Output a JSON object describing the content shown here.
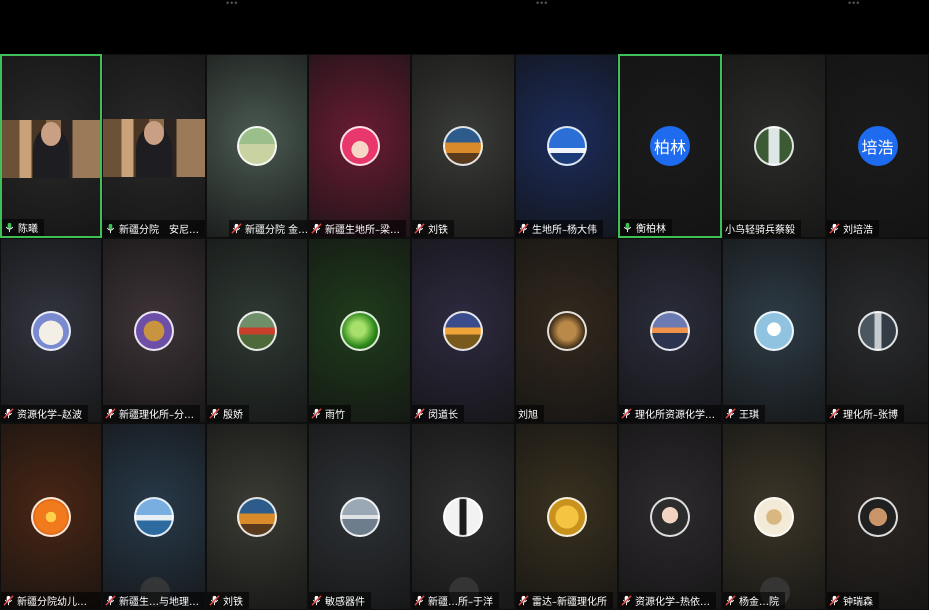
{
  "colors": {
    "active_border": "#3fbf56",
    "mic_muted": "#e24646",
    "host_badge": "#f08a1c",
    "avatar_blue": "#1f6bf0"
  },
  "participants": [
    {
      "name": "陈曦",
      "mic": "on",
      "bg": "#2a2a2a",
      "kind": "video",
      "active": true
    },
    {
      "name": "新疆分院　安尼…",
      "mic": "on",
      "bg": "#2a2a2a",
      "kind": "video",
      "active": false
    },
    {
      "name": "新疆分院 金…",
      "mic": "muted",
      "bg": "#4b5a52",
      "kind": "avatar",
      "icon": "landscape-icon",
      "host": true
    },
    {
      "name": "新疆生地所–梁…",
      "mic": "muted",
      "bg": "#6a1c34",
      "kind": "avatar",
      "icon": "cartoon-girl-icon"
    },
    {
      "name": "刘铁",
      "mic": "muted",
      "bg": "#3a3c38",
      "kind": "avatar",
      "icon": "train-sunset-icon"
    },
    {
      "name": "生地所–杨大伟",
      "mic": "muted",
      "bg": "#1c2c5c",
      "kind": "avatar",
      "icon": "blue-sky-icon"
    },
    {
      "name": "衡柏林",
      "mic": "on",
      "bg": "#1b1b1b",
      "kind": "text-avatar",
      "initials": "柏林",
      "active": true
    },
    {
      "name": "小鸟轻骑兵蔡毅",
      "mic": "none",
      "bg": "#2c2d2a",
      "kind": "avatar",
      "icon": "waterfall-icon"
    },
    {
      "name": "刘培浩",
      "mic": "muted",
      "bg": "#1b1b1b",
      "kind": "text-avatar",
      "initials": "培浩"
    },
    {
      "name": "资源化学–赵波",
      "mic": "muted",
      "bg": "#32343e",
      "kind": "avatar",
      "icon": "cartoon-character-icon"
    },
    {
      "name": "新疆理化所–分…",
      "mic": "muted",
      "bg": "#3e3438",
      "kind": "avatar",
      "icon": "cat-icon"
    },
    {
      "name": "殷娇",
      "mic": "muted",
      "bg": "#2f3a34",
      "kind": "avatar",
      "icon": "flowers-icon"
    },
    {
      "name": "雨竹",
      "mic": "muted",
      "bg": "#203c1c",
      "kind": "avatar",
      "icon": "leaf-icon"
    },
    {
      "name": "闵道长",
      "mic": "muted",
      "bg": "#2e2a40",
      "kind": "avatar",
      "icon": "sunset-field-icon"
    },
    {
      "name": "刘旭",
      "mic": "none",
      "bg": "#33291e",
      "kind": "avatar",
      "icon": "lion-icon"
    },
    {
      "name": "理化所资源化学…",
      "mic": "muted",
      "bg": "#2a2c3a",
      "kind": "avatar",
      "icon": "sea-sunset-icon"
    },
    {
      "name": "王琪",
      "mic": "muted",
      "bg": "#2e3c46",
      "kind": "avatar",
      "icon": "dandelion-icon"
    },
    {
      "name": "理化所–张博",
      "mic": "muted",
      "bg": "#2a2b2d",
      "kind": "avatar",
      "icon": "room-icon"
    },
    {
      "name": "新疆分院幼儿园…",
      "mic": "muted",
      "bg": "#4a2614",
      "kind": "avatar",
      "icon": "orange-flower-icon"
    },
    {
      "name": "新疆生…与地理…",
      "mic": "muted",
      "bg": "#283a4a",
      "kind": "avatar",
      "icon": "mountain-icon",
      "muted_overlay": true
    },
    {
      "name": "刘铁",
      "mic": "muted",
      "bg": "#3a3c34",
      "kind": "avatar",
      "icon": "train-sunset-icon"
    },
    {
      "name": "敏感器件",
      "mic": "muted",
      "bg": "#2e3236",
      "kind": "avatar",
      "icon": "lake-icon"
    },
    {
      "name": "新疆…所–于洋",
      "mic": "muted",
      "bg": "#2f2f2f",
      "kind": "avatar",
      "icon": "silhouette-icon",
      "muted_overlay": true
    },
    {
      "name": "雷达–新疆理化所",
      "mic": "muted",
      "bg": "#3a3220",
      "kind": "avatar",
      "icon": "gold-mask-icon"
    },
    {
      "name": "资源化学–热依…",
      "mic": "muted",
      "bg": "#2e2a2e",
      "kind": "avatar",
      "icon": "woman-portrait-icon"
    },
    {
      "name": "杨金…院",
      "mic": "muted",
      "bg": "#3c3628",
      "kind": "avatar",
      "icon": "cat-cartoon-icon",
      "muted_overlay": true
    },
    {
      "name": "钟瑞森",
      "mic": "muted",
      "bg": "#2c2622",
      "kind": "avatar",
      "icon": "man-portrait-icon"
    }
  ]
}
